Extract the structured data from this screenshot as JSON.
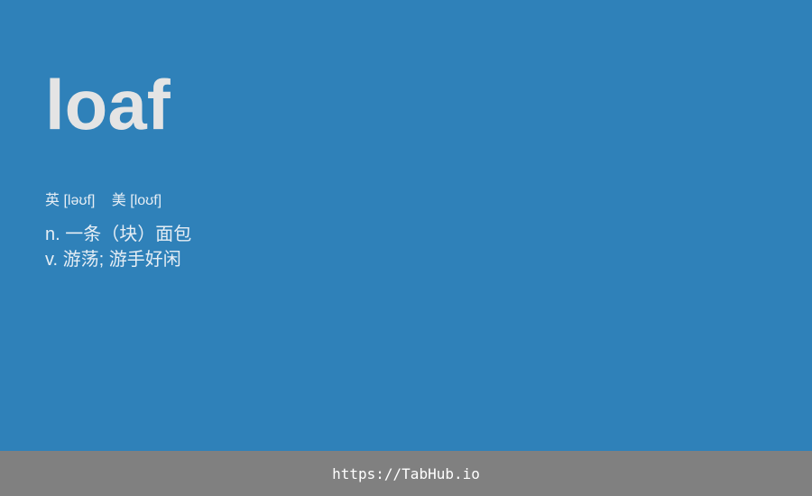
{
  "card": {
    "word": "loaf",
    "phonetics": {
      "uk": "英 [ləʊf]",
      "us": "美 [loʊf]"
    },
    "definitions": [
      "n. 一条（块）面包",
      "v. 游荡; 游手好闲"
    ]
  },
  "footer": {
    "link_text": "https://TabHub.io"
  },
  "colors": {
    "background": "#2f81b9",
    "word_text": "#e4e4e4",
    "body_text": "#e6eef5",
    "footer_background": "#808080",
    "footer_text": "#ffffff"
  }
}
